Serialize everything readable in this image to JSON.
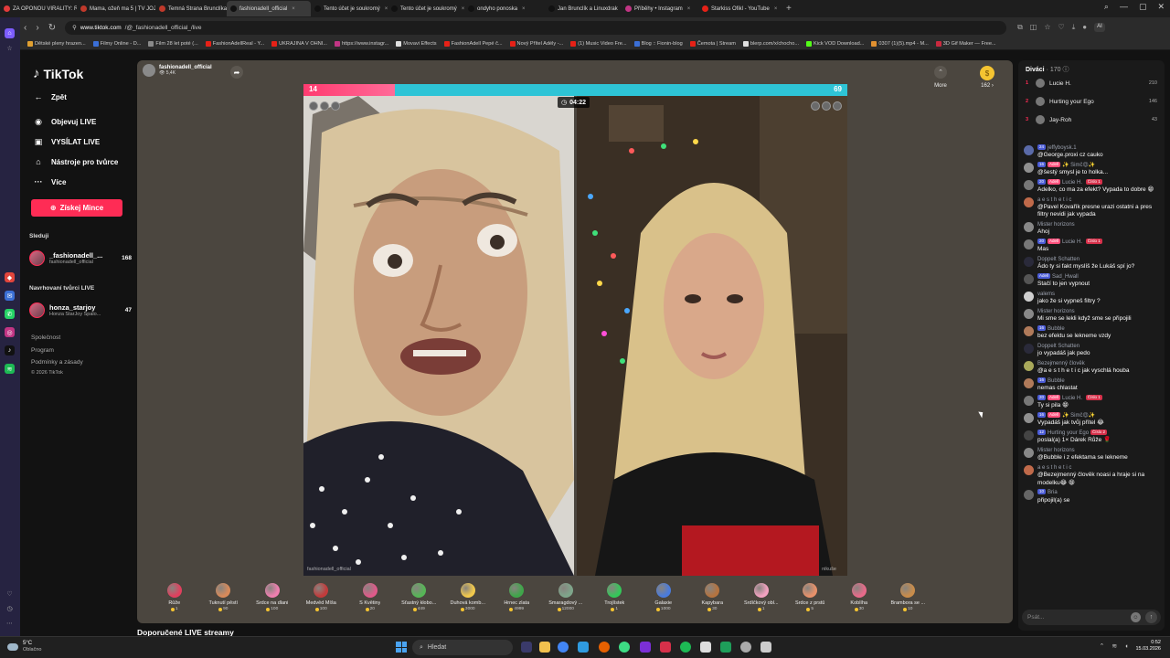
{
  "browser": {
    "tabs": [
      {
        "label": "ZA OPONOU VIRALITY: R",
        "active": false,
        "color": "#e33b3b"
      },
      {
        "label": "Mama, ožeň ma 5 | TV JOJ",
        "active": false,
        "color": "#c0392b"
      },
      {
        "label": "Temná Strana Brunclíka!",
        "active": false,
        "color": "#c0392b"
      },
      {
        "label": "fashionadell_official",
        "active": true,
        "color": "#111111"
      },
      {
        "label": "Tento účet je soukromý",
        "active": false,
        "color": "#111111"
      },
      {
        "label": "Tento účet je soukromý",
        "active": false,
        "color": "#111111"
      },
      {
        "label": "ondyho ponoska",
        "active": false,
        "color": "#111111"
      },
      {
        "label": "Jan Brunclík a Linuxdrak",
        "active": false,
        "color": "#111111"
      },
      {
        "label": "Příběhy • Instagram",
        "active": false,
        "color": "#c13584"
      },
      {
        "label": "Starkiss Ofikl - YouTube",
        "active": false,
        "color": "#e62117"
      }
    ],
    "new_tab": "+",
    "url_host": "www.tiktok.com",
    "url_path": "/@_fashionadell_official_/live",
    "ai_label": "AI",
    "bookmarks": [
      "Dětské pleny hrazen...",
      "Filmy Online - D...",
      "Film 28 let poté (...",
      "FashionAdellReal - Y...",
      "UKRAJINA V OHNI...",
      "https://www.instagr...",
      "Movavi Effects",
      "FashionAdell Pepé č...",
      "Nový Přítel Adély -...",
      "(1) Music Video Fre...",
      "Blog :: Fionin-blog",
      "Čemota | Stream",
      "blerp.com/x/chocho...",
      "Kick VOD Download...",
      "0307 (1)(5).mp4 - M...",
      "3D Gif Maker — Free..."
    ]
  },
  "sidebar": {
    "logo": "TikTok",
    "back": "Zpět",
    "links": [
      "Objevuj LIVE",
      "VYSÍLAT LIVE",
      "Nástroje pro tvůrce",
      "Více"
    ],
    "coins_button": "Získej Mince",
    "following_head": "Sleduji",
    "following": {
      "name": "_fashionadell_...",
      "sub": "fashionadell_official",
      "count": "168"
    },
    "suggested_head": "Navrhovaní tvůrci LIVE",
    "suggested": {
      "name": "honza_starjoy",
      "sub": "Honza StarJoy Spalo...",
      "count": "47"
    },
    "footer": [
      "Společnost",
      "Program",
      "Podmínky a zásady",
      "© 2026 TikTok"
    ]
  },
  "live": {
    "host_name": "fashionadell_official",
    "host_viewers": "5,4K",
    "score_left": "14",
    "score_right": "69",
    "timer": "04:22",
    "left_caption": "fashionadell_official",
    "right_caption": "nikuše"
  },
  "gifts": [
    {
      "name": "Růže",
      "price": "1",
      "color": "#e0405e"
    },
    {
      "name": "Tuknutí pěstí",
      "price": "90",
      "color": "#d88a5a"
    },
    {
      "name": "Srdce na dlani",
      "price": "100",
      "color": "#f07fb0"
    },
    {
      "name": "Medvěd Míša",
      "price": "100",
      "color": "#c23b3b"
    },
    {
      "name": "S Květiny",
      "price": "20",
      "color": "#e05a8a"
    },
    {
      "name": "Šťastný klobo...",
      "price": "449",
      "color": "#56b656"
    },
    {
      "name": "Duhová komb...",
      "price": "3000",
      "color": "#f2c94c"
    },
    {
      "name": "Hrnec zlata",
      "price": "4999",
      "color": "#3fa64a"
    },
    {
      "name": "Smaragdový ...",
      "price": "12000",
      "color": "#7ea58a"
    },
    {
      "name": "Trojlístek",
      "price": "1",
      "color": "#34c759"
    },
    {
      "name": "Galaxie",
      "price": "1000",
      "color": "#4a7bdc"
    },
    {
      "name": "Kapybara",
      "price": "30",
      "color": "#b5733f"
    },
    {
      "name": "Srdíčkový obl...",
      "price": "1",
      "color": "#f2a1c0"
    },
    {
      "name": "Srdce z prstů",
      "price": "5",
      "color": "#e8916a"
    },
    {
      "name": "Koblíha",
      "price": "30",
      "color": "#e86a8a"
    },
    {
      "name": "Brambora se ...",
      "price": "10",
      "color": "#c98c4a"
    }
  ],
  "more_label": "More",
  "coin_balance": "162",
  "recommended_title": "Doporučené LIVE streamy",
  "chat": {
    "viewers_label": "Diváci",
    "viewers_count": "· 170",
    "top_viewers": [
      {
        "rank": "1",
        "name": "Lucie H.",
        "score": "210"
      },
      {
        "rank": "2",
        "name": "Hurting your Ego",
        "score": "146"
      },
      {
        "rank": "3",
        "name": "Jay-Roh",
        "score": "43"
      }
    ],
    "messages": [
      {
        "badges": [
          [
            "b-lvl",
            "24"
          ]
        ],
        "user": "jeffyboysk.1",
        "text": "@George.proxi cz cauko",
        "color": "#5a6aa8"
      },
      {
        "badges": [
          [
            "b-lvl",
            "16"
          ],
          [
            "b-fan",
            "Adell"
          ]
        ],
        "user": "✨ Simč😍✨",
        "text": "@šestý smysl je to holka...",
        "color": "#8f8f8f"
      },
      {
        "badges": [
          [
            "b-lvl",
            "20"
          ],
          [
            "b-fan",
            "Adell"
          ]
        ],
        "user": "Lucie H. ",
        "extra": [
          [
            "b-no",
            "Číslo 1"
          ]
        ],
        "text": "Adelko, co ma za efekt? Vypada to dobre 😁",
        "color": "#777777"
      },
      {
        "badges": [],
        "user": "a e s t h e t i c",
        "text": "@Pavel Kovařík presne urazi ostatni a pres filtry nevidi jak vypada",
        "color": "#c06a4a"
      },
      {
        "badges": [],
        "user": "Mister horizons",
        "text": "Ahoj",
        "color": "#888888"
      },
      {
        "badges": [
          [
            "b-lvl",
            "20"
          ],
          [
            "b-fan",
            "Adell"
          ]
        ],
        "user": "Lucie H. ",
        "extra": [
          [
            "b-no",
            "Číslo 1"
          ]
        ],
        "text": "Mas",
        "color": "#777777"
      },
      {
        "badges": [],
        "user": "Doppelt Schatten",
        "text": "Ádo ty si fakt myslíš že Lukáš spí jo?",
        "color": "#2a2a3a"
      },
      {
        "badges": [
          [
            "b-lvl",
            "Adell"
          ]
        ],
        "user": "Sad_Hwall",
        "text": "Stačí to jen vypnout",
        "color": "#555555"
      },
      {
        "badges": [],
        "user": "valems",
        "text": "jako že si vypneš filtry ?",
        "color": "#cfcfcf"
      },
      {
        "badges": [],
        "user": "Mister horizons",
        "text": "Mi sme se lekli když sme se připojili",
        "color": "#888888"
      },
      {
        "badges": [
          [
            "b-lvl",
            "16"
          ]
        ],
        "user": "Bubble",
        "text": "bez efektu se lekneme vzdy",
        "color": "#b07a5a"
      },
      {
        "badges": [],
        "user": "Doppelt Schatten",
        "text": "jo vypadáš jak pedo",
        "color": "#2a2a3a"
      },
      {
        "badges": [],
        "user": "Bezejmenný člověk",
        "text": "@a e s t h e t i c  jak vyschlá houba",
        "color": "#a8a85a"
      },
      {
        "badges": [
          [
            "b-lvl",
            "16"
          ]
        ],
        "user": "Bubble",
        "text": "nemas chlastat",
        "color": "#b07a5a"
      },
      {
        "badges": [
          [
            "b-lvl",
            "20"
          ],
          [
            "b-fan",
            "Adell"
          ]
        ],
        "user": "Lucie H. ",
        "extra": [
          [
            "b-no",
            "Číslo 1"
          ]
        ],
        "text": "Ty si pila 😁",
        "color": "#777777"
      },
      {
        "badges": [
          [
            "b-lvl",
            "16"
          ],
          [
            "b-fan",
            "Adell"
          ]
        ],
        "user": "✨ Simč😍✨",
        "text": "Vypadáš jak tvůj přítel 😂",
        "color": "#8f8f8f"
      },
      {
        "badges": [
          [
            "b-lvl",
            "12"
          ]
        ],
        "user": "Hurting your Ego",
        "extra": [
          [
            "b-no",
            "Číslo 2"
          ]
        ],
        "text": "poslal(a) 1× Dárek Růže 🌹",
        "color": "#444444"
      },
      {
        "badges": [],
        "user": "Mister horizons",
        "text": "@Bubble i z efektama se lekneme",
        "color": "#888888"
      },
      {
        "badges": [],
        "user": "a e s t h e t i c",
        "text": "@Bezejmenný člověk noasi a hraje si na modelku😂 😁",
        "color": "#c06a4a"
      },
      {
        "badges": [
          [
            "b-lvl",
            "10"
          ]
        ],
        "user": "Bria",
        "text": "připojil(a) se",
        "color": "#666666"
      }
    ],
    "input_placeholder": "Psát..."
  },
  "taskbar": {
    "temp": "5°C",
    "weather": "Oblačno",
    "search": "Hledat",
    "time": "0:52",
    "date": "15.03.2026"
  }
}
